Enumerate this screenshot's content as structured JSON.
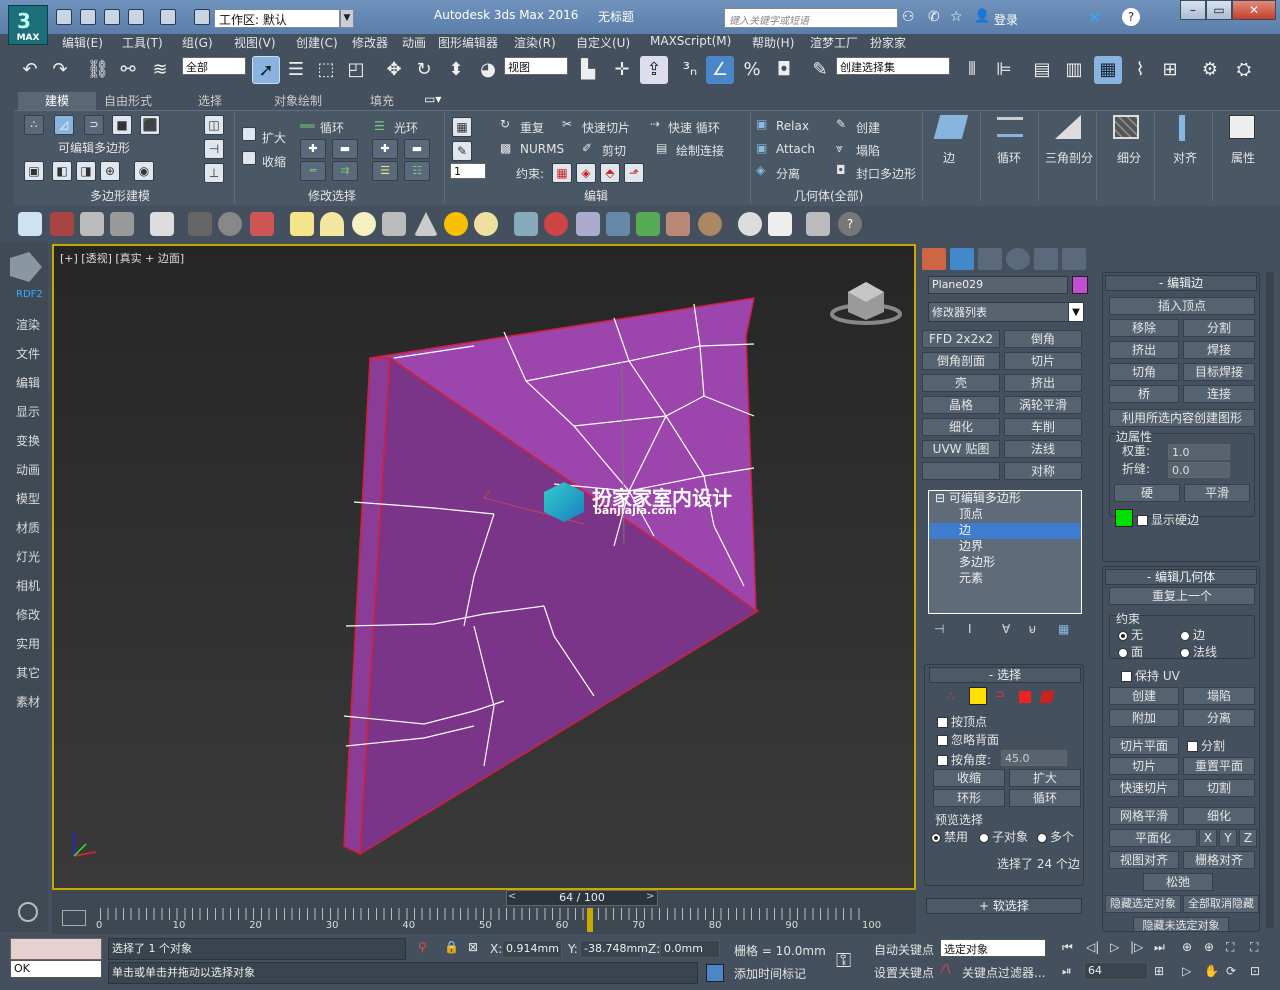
{
  "titlebar": {
    "logo_text": "MAX",
    "workspace": "工作区: 默认",
    "app_title": "Autodesk 3ds Max 2016",
    "doc_title": "无标题",
    "search_placeholder": "键入关键字或短语",
    "login": "登录"
  },
  "menus": [
    "编辑(E)",
    "工具(T)",
    "组(G)",
    "视图(V)",
    "创建(C)",
    "修改器",
    "动画",
    "图形编辑器",
    "渲染(R)",
    "自定义(U)",
    "MAXScript(M)",
    "帮助(H)",
    "渲梦工厂",
    "扮家家"
  ],
  "toolbar": {
    "filter": "全部",
    "ref_coord": "视图",
    "named_selection": "创建选择集"
  },
  "ribbon": {
    "tabs": [
      "建模",
      "自由形式",
      "选择",
      "对象绘制",
      "填充"
    ],
    "panel_labels": [
      "多边形建模",
      "修改选择",
      "编辑",
      "几何体(全部)"
    ],
    "poly_label": "可编辑多边形",
    "grow": "扩大",
    "shrink": "收缩",
    "loop": "循环",
    "ring": "光环",
    "repeat": "重复",
    "quickslice": "快速切片",
    "quickloop": "快速 循环",
    "nurms": "NURMS",
    "cut": "剪切",
    "paintconnect": "绘制连接",
    "constraints": "约束:",
    "spin_value": "1",
    "relax": "Relax",
    "create": "创建",
    "attach": "Attach",
    "collapse": "塌陷",
    "detach": "分离",
    "cap": "封口多边形",
    "big_buttons": [
      "边",
      "循环",
      "三角剖分",
      "细分",
      "对齐",
      "属性"
    ]
  },
  "sidebar": {
    "items": [
      "RDF2",
      "渲染",
      "文件",
      "编辑",
      "显示",
      "变换",
      "动画",
      "模型",
      "材质",
      "灯光",
      "相机",
      "修改",
      "实用",
      "其它",
      "素材"
    ]
  },
  "viewport": {
    "label": "[+] [透视] [真实 + 边面]",
    "watermark_title": "扮家家室内设计",
    "watermark_url": "banjiajia.com"
  },
  "command_panel": {
    "object_name": "Plane029",
    "object_color": "#c050d0",
    "modifier_list": "修改器列表",
    "modifier_buttons": [
      "FFD 2x2x2",
      "倒角",
      "倒角剖面",
      "切片",
      "壳",
      "挤出",
      "晶格",
      "涡轮平滑",
      "细化",
      "车削",
      "UVW 贴图",
      "法线",
      "",
      "对称"
    ],
    "stack": {
      "root": "可编辑多边形",
      "items": [
        "顶点",
        "边",
        "边界",
        "多边形",
        "元素"
      ],
      "selected": "边"
    },
    "selection": {
      "title": "选择",
      "by_vertex": "按顶点",
      "ignore_backface": "忽略背面",
      "by_angle": "按角度:",
      "angle_value": "45.0",
      "shrink": "收缩",
      "grow": "扩大",
      "ring": "环形",
      "loop": "循环",
      "preview_title": "预览选择",
      "preview_options": [
        "禁用",
        "子对象",
        "多个"
      ],
      "status": "选择了 24 个边"
    },
    "soft_selection": "软选择",
    "edit_edges": {
      "title": "编辑边",
      "insert_vertex": "插入顶点",
      "remove": "移除",
      "split": "分割",
      "extrude": "挤出",
      "weld": "焊接",
      "chamfer": "切角",
      "target_weld": "目标焊接",
      "bridge": "桥",
      "connect": "连接",
      "create_shape": "利用所选内容创建图形",
      "edge_props": "边属性",
      "weight_label": "权重:",
      "weight_value": "1.0",
      "crease_label": "折缝:",
      "crease_value": "0.0",
      "hard": "硬",
      "smooth": "平滑",
      "show_hard": "显示硬边",
      "hard_color": "#00e000"
    },
    "edit_geometry": {
      "title": "编辑几何体",
      "repeat_last": "重复上一个",
      "constraints_title": "约束",
      "constraint_options": [
        "无",
        "边",
        "面",
        "法线"
      ],
      "preserve_uv": "保持 UV",
      "create": "创建",
      "collapse": "塌陷",
      "attach": "附加",
      "detach": "分离",
      "slice_plane": "切片平面",
      "split": "分割",
      "slice": "切片",
      "reset_plane": "重置平面",
      "quickslice": "快速切片",
      "cut": "切割",
      "meshsmooth": "网格平滑",
      "tessellate": "细化",
      "make_planar": "平面化",
      "x": "X",
      "y": "Y",
      "z": "Z",
      "view_align": "视图对齐",
      "grid_align": "栅格对齐",
      "relax": "松弛",
      "hide_sel": "隐藏选定对象",
      "unhide_all": "全部取消隐藏",
      "hide_unsel": "隐藏未选定对象"
    }
  },
  "timeline": {
    "frame_display": "64 / 100",
    "ticks": [
      "0",
      "10",
      "20",
      "30",
      "40",
      "50",
      "60",
      "70",
      "80",
      "90",
      "100"
    ],
    "current_frame": 64,
    "total_frames": 100
  },
  "statusbar": {
    "ok": "OK",
    "selected": "选择了 1 个对象",
    "prompt": "单击或单击并拖动以选择对象",
    "x": "0.914mm",
    "y": "-38.748mm",
    "z": "0.0mm",
    "x_label": "X:",
    "y_label": "Y:",
    "z_label": "Z:",
    "grid": "栅格 = 10.0mm",
    "add_time_tag": "添加时间标记",
    "auto_key": "自动关键点",
    "set_key": "设置关键点",
    "key_mode": "选定对象",
    "key_filters": "关键点过滤器...",
    "frame": "64"
  }
}
